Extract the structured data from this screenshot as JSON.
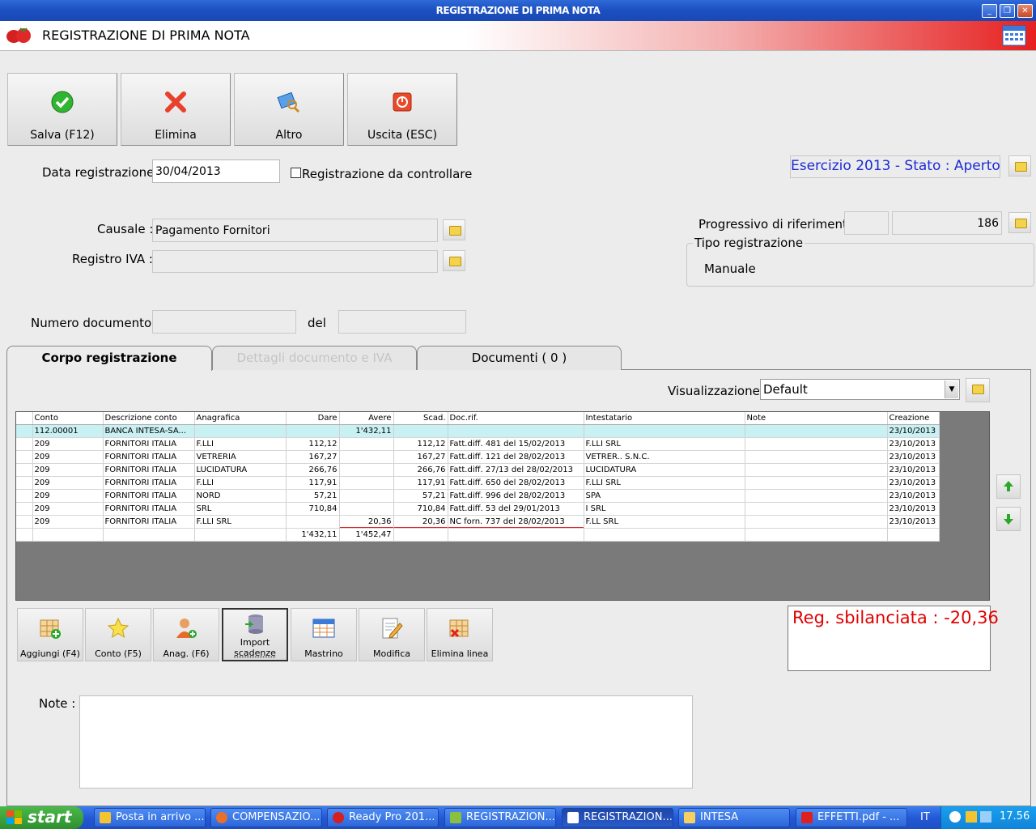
{
  "window": {
    "title": "REGISTRAZIONE DI PRIMA NOTA",
    "header_title": "REGISTRAZIONE DI PRIMA NOTA"
  },
  "toolbar": {
    "save": "Salva (F12)",
    "delete": "Elimina",
    "other": "Altro",
    "exit": "Uscita (ESC)"
  },
  "form": {
    "date_label": "Data registrazione :",
    "date_value": "30/04/2013",
    "check_label": "Registrazione da controllare",
    "causale_label": "Causale :",
    "causale_value": "Pagamento Fornitori",
    "registro_label": "Registro IVA :",
    "registro_value": "",
    "numdoc_label": "Numero documento :",
    "numdoc_value": "",
    "del_label": "del",
    "del_value": "",
    "esercizio": "Esercizio 2013   - Stato : Aperto",
    "progressivo_label": "Progressivo di riferimento :",
    "progressivo_a": "",
    "progressivo_b": "186",
    "tipo_label": "Tipo registrazione",
    "tipo_value": "Manuale"
  },
  "tabs": {
    "corpo": "Corpo registrazione",
    "dettagli": "Dettagli documento e IVA",
    "documenti": "Documenti ( 0 )"
  },
  "view": {
    "label": "Visualizzazione :",
    "value": "Default"
  },
  "grid": {
    "headers": [
      "Conto",
      "Descrizione conto",
      "Anagrafica",
      "Dare",
      "Avere",
      "Scad.",
      "Doc.rif.",
      "Intestatario",
      "Note",
      "Creazione"
    ],
    "rows": [
      [
        "112.00001",
        "BANCA INTESA-SA...",
        "",
        "",
        "1'432,11",
        "",
        "",
        "",
        "",
        "23/10/2013"
      ],
      [
        "209",
        "FORNITORI ITALIA",
        "F.LLI",
        "112,12",
        "",
        "112,12",
        "Fatt.diff. 481 del 15/02/2013",
        "F.LLI          SRL",
        "",
        "23/10/2013"
      ],
      [
        "209",
        "FORNITORI ITALIA",
        "VETRERIA",
        "167,27",
        "",
        "167,27",
        "Fatt.diff. 121 del 28/02/2013",
        "VETRER..     S.N.C.",
        "",
        "23/10/2013"
      ],
      [
        "209",
        "FORNITORI ITALIA",
        "LUCIDATURA",
        "266,76",
        "",
        "266,76",
        "Fatt.diff. 27/13 del 28/02/2013",
        "LUCIDATURA",
        "",
        "23/10/2013"
      ],
      [
        "209",
        "FORNITORI ITALIA",
        "F.LLI",
        "117,91",
        "",
        "117,91",
        "Fatt.diff. 650 del 28/02/2013",
        "F.LLI          SRL",
        "",
        "23/10/2013"
      ],
      [
        "209",
        "FORNITORI ITALIA",
        "NORD",
        "57,21",
        "",
        "57,21",
        "Fatt.diff. 996 del 28/02/2013",
        "               SPA",
        "",
        "23/10/2013"
      ],
      [
        "209",
        "FORNITORI ITALIA",
        "             SRL",
        "710,84",
        "",
        "710,84",
        "Fatt.diff. 53 del 29/01/2013",
        "          I SRL",
        "",
        "23/10/2013"
      ],
      [
        "209",
        "FORNITORI ITALIA",
        "F.LLI         SRL",
        "",
        "20,36",
        "20,36",
        "NC forn. 737 del 28/02/2013",
        "F.LL         SRL",
        "",
        "23/10/2013"
      ]
    ],
    "total_dare": "1'432,11",
    "total_avere": "1'452,47"
  },
  "actions": {
    "add": "Aggiungi (F4)",
    "account": "Conto (F5)",
    "anag": "Anag. (F6)",
    "import_line1": "Import",
    "import_line2": "scadenze",
    "ledger": "Mastrino",
    "edit": "Modifica",
    "delete_line": "Elimina linea"
  },
  "status": {
    "unbalanced": "Reg. sbilanciata : -20,36"
  },
  "notes": {
    "label": "Note :",
    "value": ""
  },
  "taskbar": {
    "start": "start",
    "items": [
      "Posta in arrivo ...",
      "COMPENSAZIO...",
      "Ready Pro 201...",
      "REGISTRAZION...",
      "REGISTRAZION...",
      "INTESA",
      "EFFETTI.pdf - ..."
    ],
    "lang": "IT",
    "clock": "17.56"
  },
  "colors": {
    "accent_blue": "#1c2bd6",
    "error_red": "#e00000",
    "selected_row": "#c9f0f2"
  }
}
